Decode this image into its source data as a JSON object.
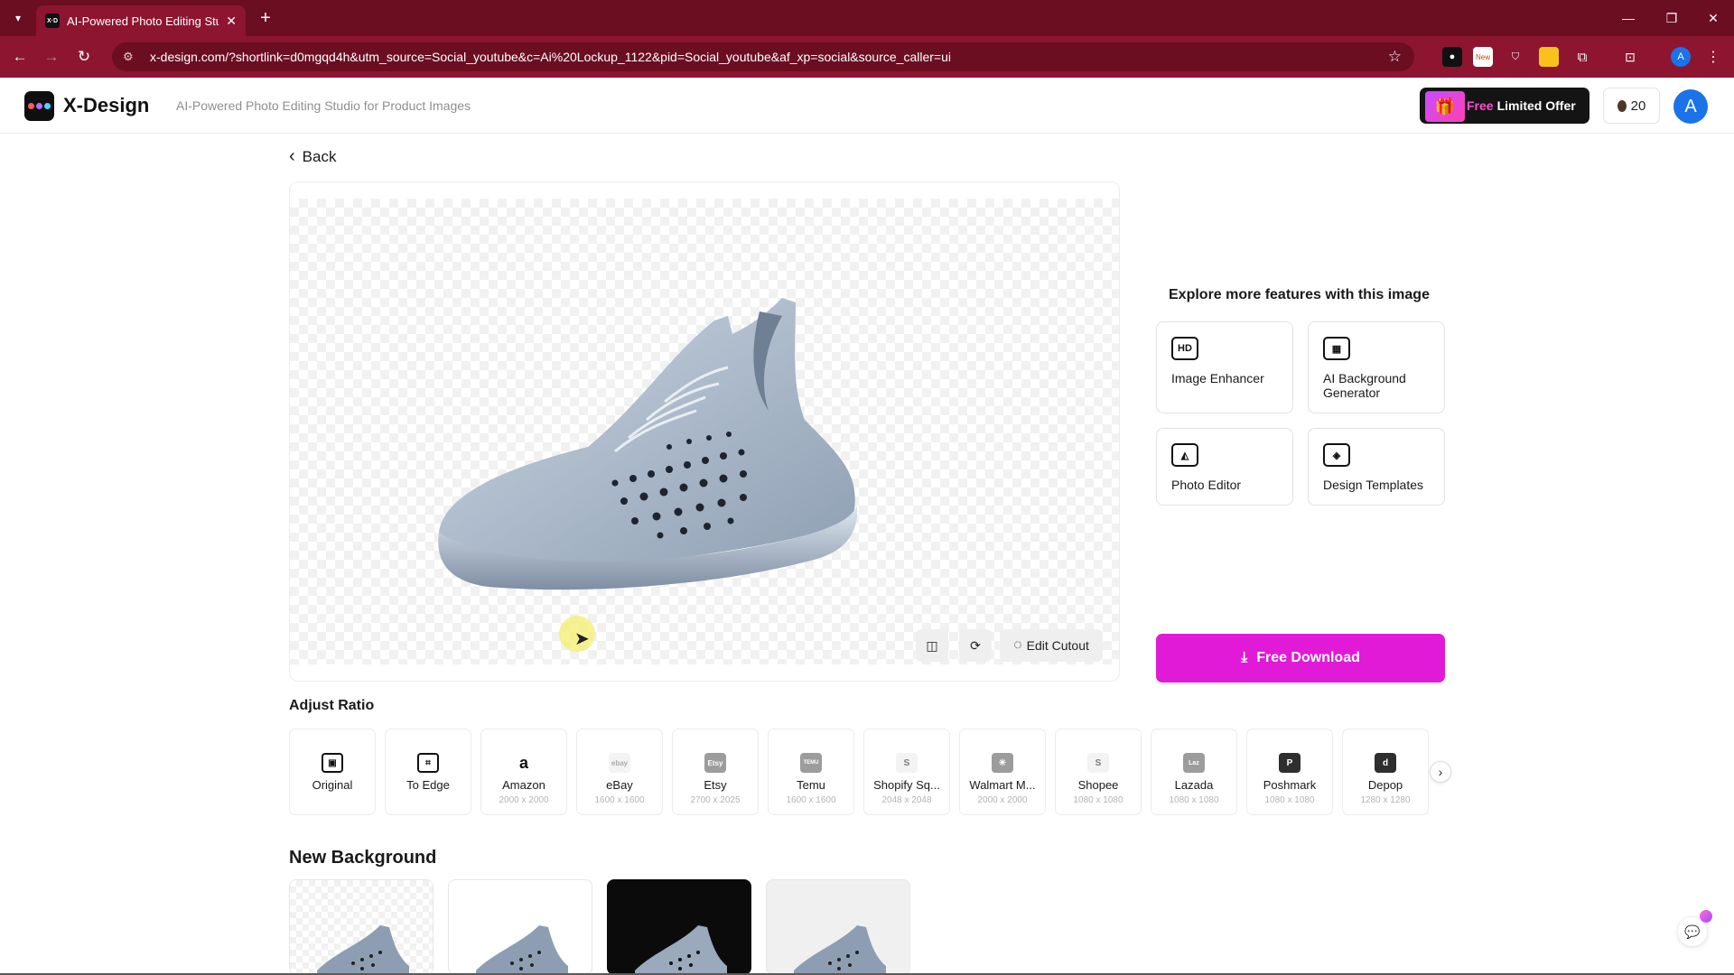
{
  "browser": {
    "tab_title": "AI-Powered Photo Editing Studi",
    "url": "x-design.com/?shortlink=d0mgqd4h&utm_source=Social_youtube&c=Ai%20Lockup_1122&pid=Social_youtube&af_xp=social&source_caller=ui",
    "ext_new_badge": "New"
  },
  "header": {
    "logo_text": "X-Design",
    "tagline": "AI-Powered Photo Editing Studio for Product Images",
    "offer_free": "Free",
    "offer_rest": "Limited Offer",
    "credits": "20",
    "avatar_initial": "A"
  },
  "main": {
    "back_label": "Back",
    "edit_cutout_label": "Edit Cutout"
  },
  "explore": {
    "title": "Explore more features with this image",
    "features": [
      {
        "label": "Image Enhancer",
        "icon": "hd-icon",
        "icon_text": "HD"
      },
      {
        "label": "AI Background Generator",
        "icon": "ai-background-icon"
      },
      {
        "label": "Photo Editor",
        "icon": "photo-editor-icon"
      },
      {
        "label": "Design Templates",
        "icon": "design-templates-icon"
      }
    ],
    "download_label": "Free Download"
  },
  "adjust_ratio": {
    "title": "Adjust Ratio",
    "items": [
      {
        "name": "Original",
        "size": ""
      },
      {
        "name": "To Edge",
        "size": ""
      },
      {
        "name": "Amazon",
        "size": "2000 x 2000",
        "icon_text": "a"
      },
      {
        "name": "eBay",
        "size": "1600 x 1600",
        "icon_text": "ebay"
      },
      {
        "name": "Etsy",
        "size": "2700 x 2025",
        "icon_text": "Etsy"
      },
      {
        "name": "Temu",
        "size": "1600 x 1600",
        "icon_text": "TEMU"
      },
      {
        "name": "Shopify Sq...",
        "size": "2048 x 2048",
        "icon_text": "S"
      },
      {
        "name": "Walmart M...",
        "size": "2000 x 2000",
        "icon_text": "✳"
      },
      {
        "name": "Shopee",
        "size": "1080 x 1080",
        "icon_text": "S"
      },
      {
        "name": "Lazada",
        "size": "1080 x 1080",
        "icon_text": "Laz"
      },
      {
        "name": "Poshmark",
        "size": "1080 x 1080",
        "icon_text": "P"
      },
      {
        "name": "Depop",
        "size": "1280 x 1280",
        "icon_text": "d"
      }
    ]
  },
  "new_background": {
    "title": "New Background"
  },
  "colors": {
    "browser_frame": "#8d1530",
    "download_accent": "#e11ad7",
    "offer_accent": "#ff4fd2"
  }
}
